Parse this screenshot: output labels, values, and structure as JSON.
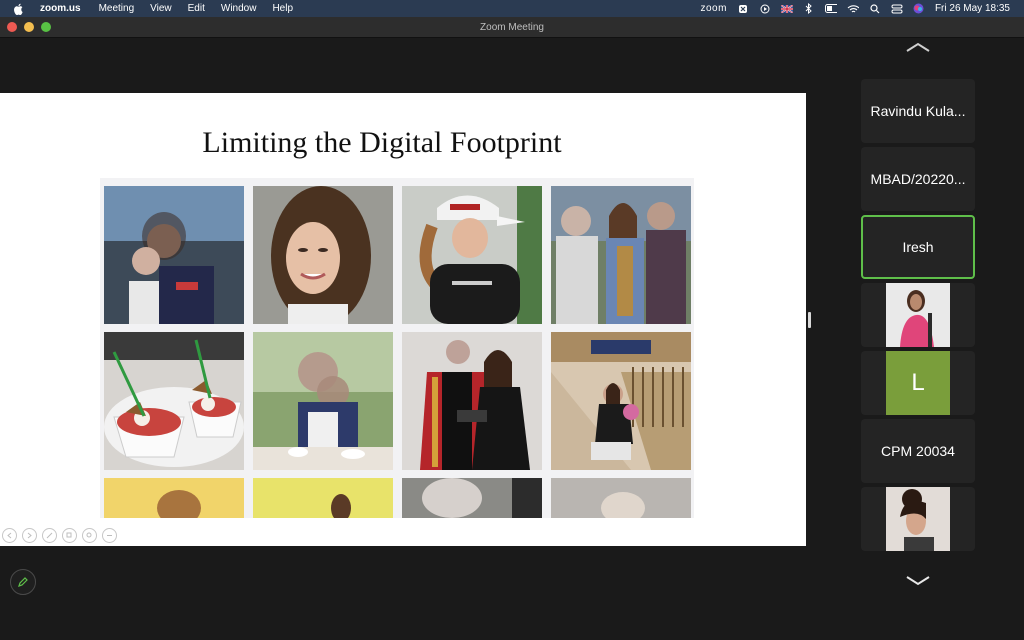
{
  "menubar": {
    "app_name": "zoom.us",
    "items": [
      "Meeting",
      "View",
      "Edit",
      "Window",
      "Help"
    ],
    "status_zoom": "zoom",
    "datetime": "Fri 26 May  18:35"
  },
  "window": {
    "title": "Zoom Meeting"
  },
  "slide": {
    "title": "Limiting the Digital Footprint"
  },
  "participants": [
    {
      "name": "Ravindu Kula..."
    },
    {
      "name": "MBAD/20220..."
    },
    {
      "name": "Iresh"
    },
    {
      "name": ""
    },
    {
      "name": "L"
    },
    {
      "name": "CPM 20034"
    },
    {
      "name": ""
    }
  ],
  "icons": {
    "apple": "apple-icon",
    "pen": "pen-icon",
    "up": "chevron-up-icon",
    "down": "chevron-down-icon"
  },
  "colors": {
    "active_border": "#5fbf4a",
    "avatar_L": "#7a9e3b",
    "menubar": "#2b3b52"
  }
}
